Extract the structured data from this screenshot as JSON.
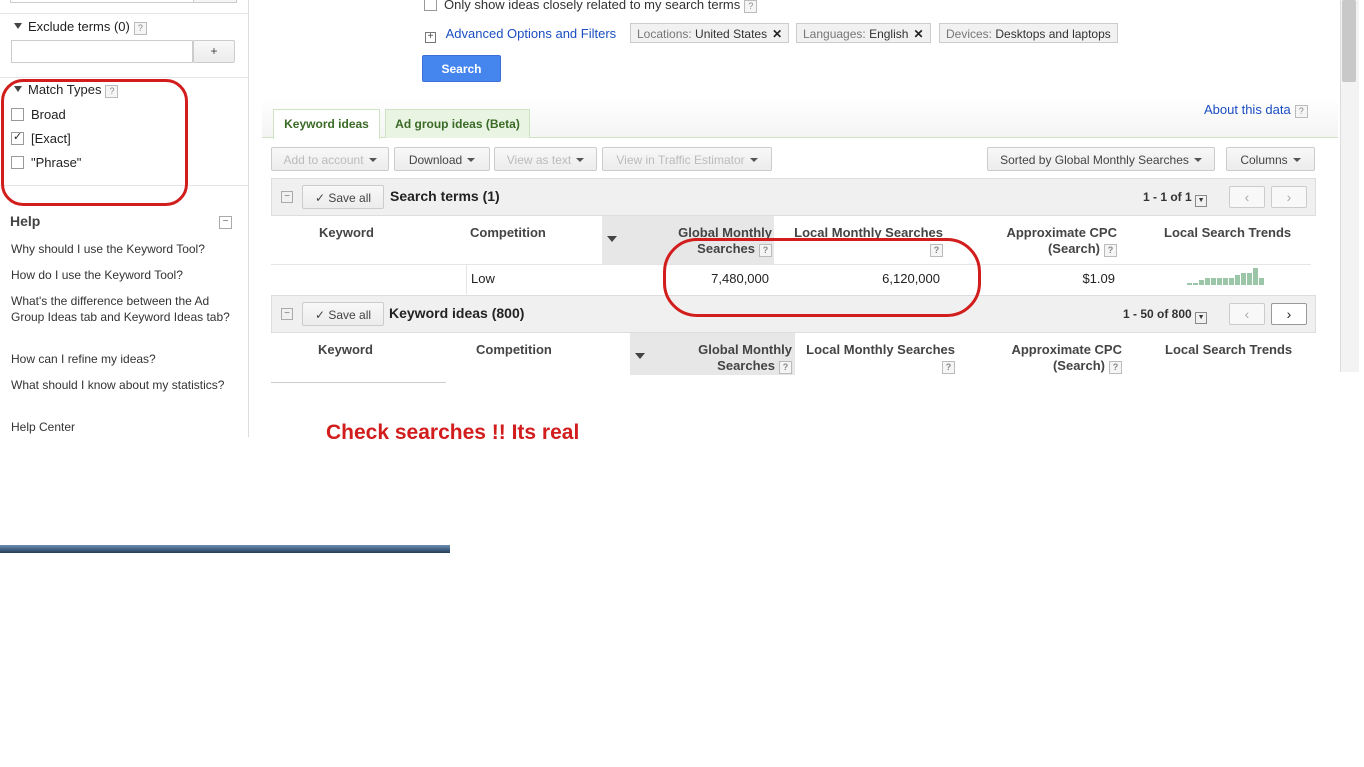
{
  "sidebar": {
    "exclude_label": "Exclude terms (0)",
    "exclude_add": "+",
    "match_types_label": "Match Types",
    "match_types": [
      {
        "label": "Broad",
        "checked": false
      },
      {
        "label": "[Exact]",
        "checked": true
      },
      {
        "label": "\"Phrase\"",
        "checked": false
      }
    ],
    "help_title": "Help",
    "help_links": [
      "Why should I use the Keyword Tool?",
      "How do I use the Keyword Tool?",
      "What's the difference between the Ad Group Ideas tab and Keyword Ideas tab?",
      "How can I refine my ideas?",
      "What should I know about my statistics?",
      "Help Center"
    ]
  },
  "options": {
    "only_show_label": "Only show ideas closely related to my search terms",
    "advanced_label": "Advanced Options and Filters",
    "chips": [
      {
        "key": "Locations:",
        "value": "United States",
        "removable": true
      },
      {
        "key": "Languages:",
        "value": "English",
        "removable": true
      },
      {
        "key": "Devices:",
        "value": "Desktops and laptops",
        "removable": false
      }
    ],
    "search_button": "Search"
  },
  "tabs": {
    "keyword_ideas": "Keyword ideas",
    "ad_group_ideas": "Ad group ideas (Beta)",
    "about_data": "About this data"
  },
  "toolbar": {
    "add_to_account": "Add to account",
    "download": "Download",
    "view_as_text": "View as text",
    "view_traffic": "View in Traffic Estimator",
    "sorted_by": "Sorted by Global Monthly Searches",
    "columns": "Columns"
  },
  "search_terms": {
    "save_all": "Save all",
    "title": "Search terms (1)",
    "pagination": "1 - 1 of 1",
    "columns": {
      "keyword": "Keyword",
      "competition": "Competition",
      "global": "Global Monthly Searches",
      "local": "Local Monthly Searches",
      "cpc": "Approximate CPC (Search)",
      "trends": "Local Search Trends"
    },
    "row": {
      "competition": "Low",
      "global": "7,480,000",
      "local": "6,120,000",
      "cpc": "$1.09",
      "trend": [
        1,
        1,
        2,
        3,
        3,
        3,
        3,
        3,
        4,
        5,
        5,
        7,
        3
      ]
    }
  },
  "keyword_ideas": {
    "save_all": "Save all",
    "title": "Keyword ideas (800)",
    "pagination": "1 - 50 of 800",
    "columns": {
      "keyword": "Keyword",
      "competition": "Competition",
      "global": "Global Monthly Searches",
      "local": "Local Monthly Searches",
      "cpc": "Approximate CPC (Search)",
      "trends": "Local Search Trends"
    }
  },
  "annotation": {
    "text": "Check searches !! Its real",
    "color": "#d21d1d"
  }
}
